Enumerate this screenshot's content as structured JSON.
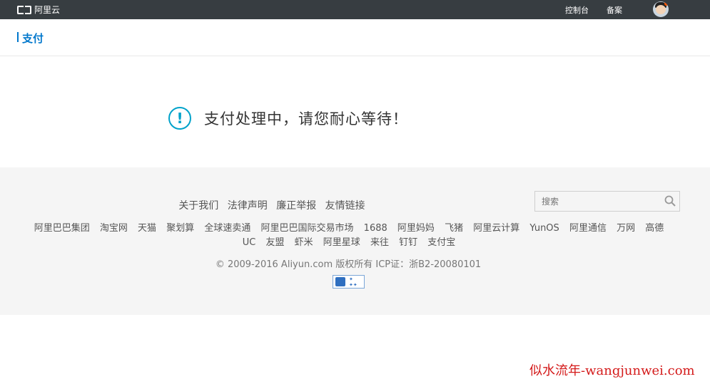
{
  "topbar": {
    "logo_text": "阿里云",
    "links": [
      "控制台",
      "备案"
    ]
  },
  "subheader": {
    "title": "支付"
  },
  "status": {
    "icon": "!",
    "message": "支付处理中，请您耐心等待！"
  },
  "footer": {
    "links": [
      "关于我们",
      "法律声明",
      "廉正举报",
      "友情链接"
    ],
    "search_placeholder": "搜索",
    "sites": [
      "阿里巴巴集团",
      "淘宝网",
      "天猫",
      "聚划算",
      "全球速卖通",
      "阿里巴巴国际交易市场",
      "1688",
      "阿里妈妈",
      "飞猪",
      "阿里云计算",
      "YunOS",
      "阿里通信",
      "万网",
      "高德",
      "UC",
      "友盟",
      "虾米",
      "阿里星球",
      "来往",
      "钉钉",
      "支付宝"
    ],
    "copyright": "© 2009-2016 Aliyun.com 版权所有 ICP证：浙B2-20080101"
  },
  "watermark": "似水流年-wangjunwei.com",
  "colors": {
    "accent": "#0077cc",
    "topbar": "#373d41",
    "status_icon": "#00a2ca"
  }
}
